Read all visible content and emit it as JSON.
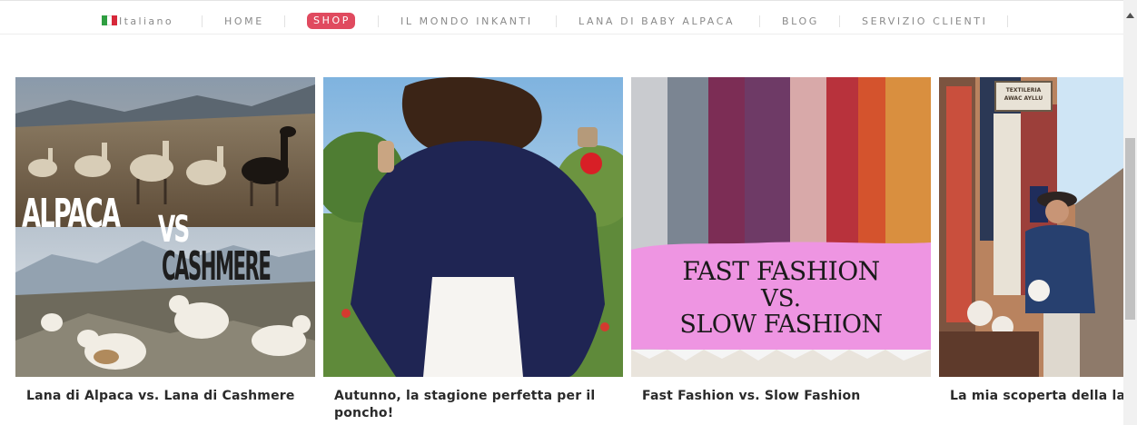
{
  "nav": {
    "language": "Italiano",
    "items": [
      "HOME",
      "SHOP",
      "IL MONDO INKANTI",
      "LANA DI BABY ALPACA",
      "BLOG",
      "SERVIZIO CLIENTI"
    ],
    "active": "SHOP",
    "accent_color": "#e04a5f"
  },
  "cards": [
    {
      "title": "Lana di Alpaca vs. Lana di Cashmere",
      "image": {
        "icon": "alpaca-vs-cashmere-photo",
        "overlay_line1": "ALPACA",
        "overlay_vs": "VS",
        "overlay_line2": "CASHMERE"
      }
    },
    {
      "title": "Autunno, la stagione perfetta per il poncho!",
      "image": {
        "icon": "woman-in-navy-poncho-photo"
      }
    },
    {
      "title": "Fast Fashion vs. Slow Fashion",
      "image": {
        "icon": "hanging-scarves-photo",
        "overlay_line1": "FAST FASHION",
        "overlay_vs": "VS.",
        "overlay_line2": "SLOW FASHION"
      }
    },
    {
      "title": "La mia scoperta della lana di alpaca",
      "image": {
        "icon": "woman-at-market-photo",
        "sign": "TEXTILERIA AWAC AYLLU"
      }
    }
  ]
}
